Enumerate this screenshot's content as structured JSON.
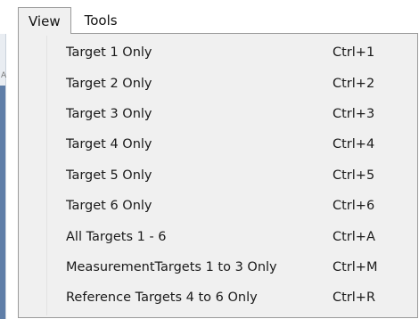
{
  "menubar": {
    "menus": [
      {
        "label": "View",
        "open": true
      },
      {
        "label": "Tools",
        "open": false
      }
    ]
  },
  "view_menu": {
    "items": [
      {
        "label": "Target 1 Only",
        "shortcut": "Ctrl+1"
      },
      {
        "label": "Target 2 Only",
        "shortcut": "Ctrl+2"
      },
      {
        "label": "Target 3 Only",
        "shortcut": "Ctrl+3"
      },
      {
        "label": "Target 4 Only",
        "shortcut": "Ctrl+4"
      },
      {
        "label": "Target 5 Only",
        "shortcut": "Ctrl+5"
      },
      {
        "label": "Target 6 Only",
        "shortcut": "Ctrl+6"
      },
      {
        "label": "All Targets 1 - 6",
        "shortcut": "Ctrl+A"
      },
      {
        "label": "MeasurementTargets 1 to 3 Only",
        "shortcut": "Ctrl+M"
      },
      {
        "label": "Reference Targets 4 to 6  Only",
        "shortcut": "Ctrl+R"
      }
    ]
  },
  "background": {
    "fragment_text": "A"
  }
}
